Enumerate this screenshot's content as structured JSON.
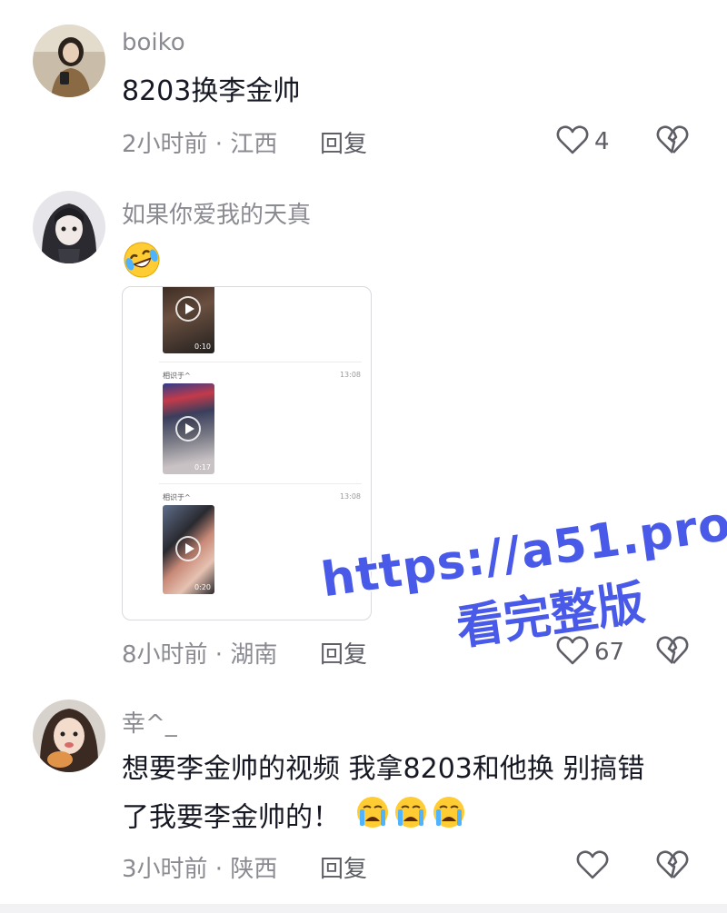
{
  "comments": [
    {
      "username": "boiko",
      "text": "8203换李金帅",
      "time": "2小时前 · 江西",
      "reply_label": "回复",
      "likes": "4"
    },
    {
      "username": "如果你爱我的天真",
      "emoji": "laughing-crying-emoji",
      "time": "8小时前 · 湖南",
      "reply_label": "回复",
      "likes": "67",
      "attachment": {
        "messages": [
          {
            "duration": "0:10"
          },
          {
            "sender": "相识于^",
            "time": "13:08",
            "duration": "0:17"
          },
          {
            "sender": "相识于^",
            "time": "13:08",
            "duration": "0:20"
          }
        ]
      }
    },
    {
      "username": "幸^_",
      "text_line1": "想要李金帅的视频 我拿8203和他换 别搞错",
      "text_line2": "了我要李金帅的！",
      "time": "3小时前 · 陕西",
      "reply_label": "回复"
    }
  ],
  "watermark": {
    "line1": "https://a51.pro",
    "line2": "看完整版",
    "color": "#4a5ae8"
  },
  "icons": {
    "like": "heart-outline-icon",
    "dislike": "broken-heart-icon"
  }
}
